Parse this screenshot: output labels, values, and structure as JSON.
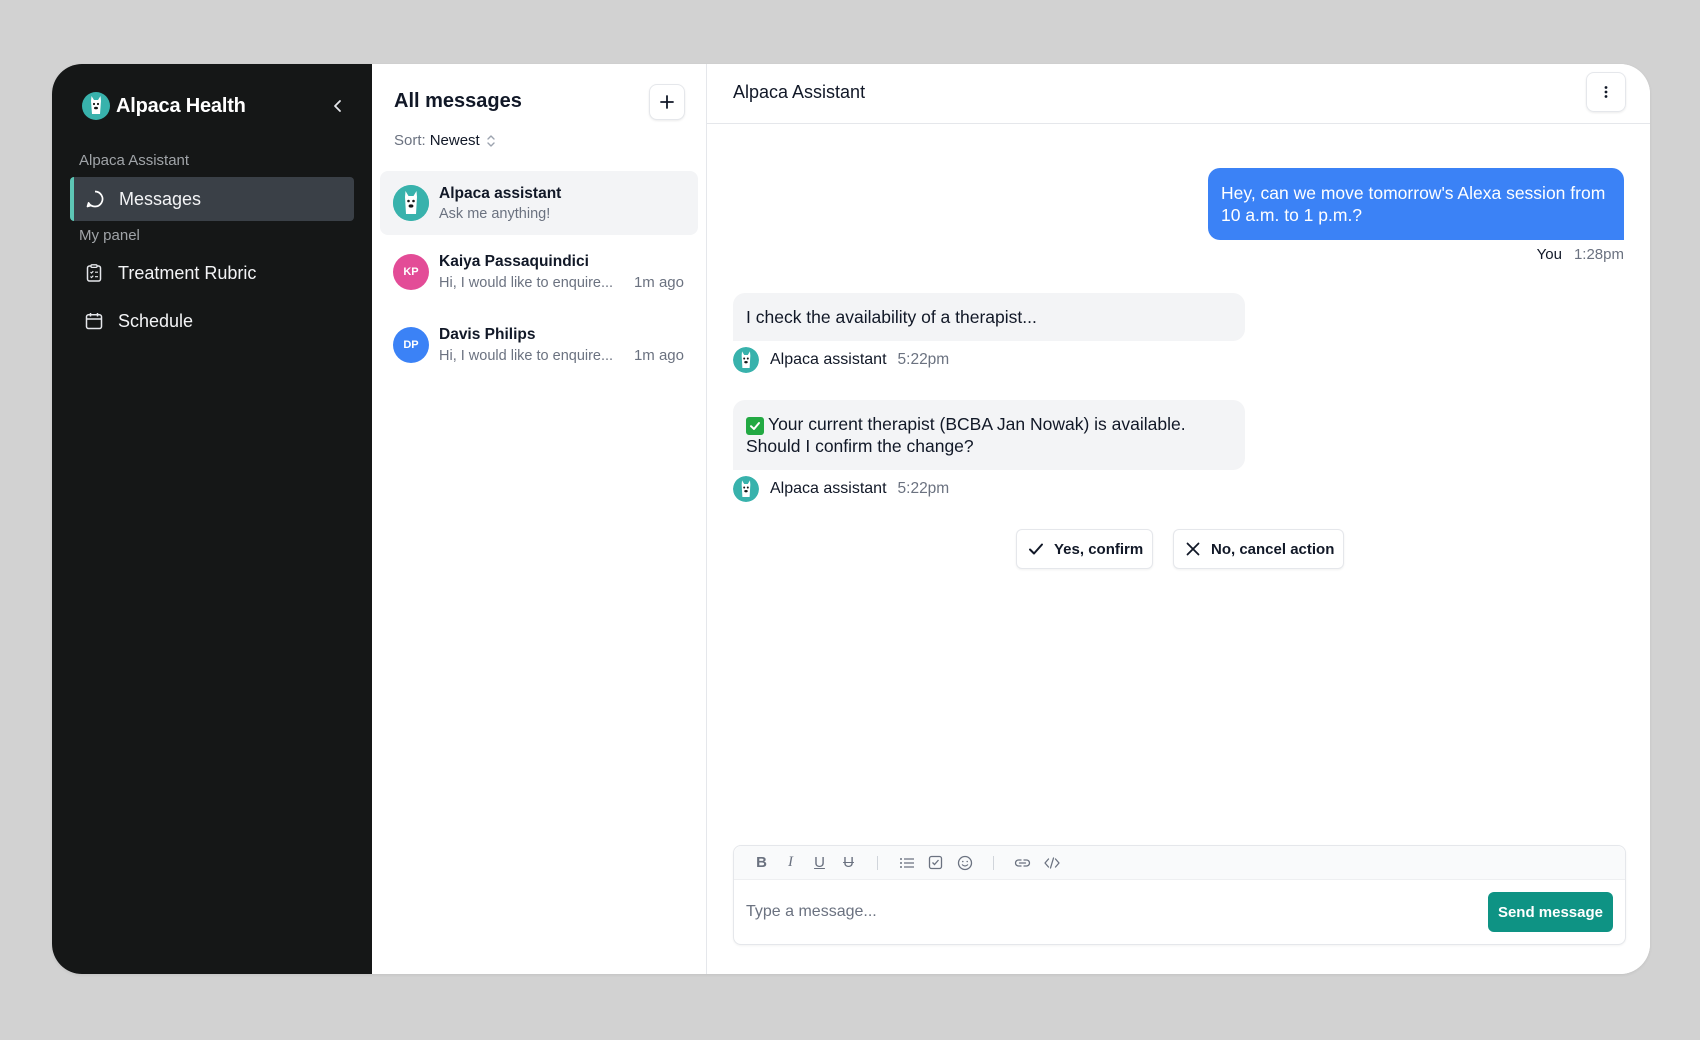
{
  "brand": {
    "name": "Alpaca Health"
  },
  "sidebar": {
    "sections": [
      {
        "label": "Alpaca Assistant"
      },
      {
        "label": "My panel"
      }
    ],
    "items": [
      {
        "label": "Messages",
        "icon": "chat-bubble-icon",
        "active": true
      },
      {
        "label": "Treatment Rubric",
        "icon": "clipboard-icon"
      },
      {
        "label": "Schedule",
        "icon": "calendar-icon"
      }
    ]
  },
  "list": {
    "title": "All messages",
    "sort_label": "Sort:",
    "sort_value": "Newest",
    "conversations": [
      {
        "name": "Alpaca assistant",
        "preview": "Ask me anything!",
        "time": "",
        "initials": "",
        "color": "#38b2ac"
      },
      {
        "name": "Kaiya Passaquindici",
        "preview": "Hi, I would like to enquire...",
        "time": "1m ago",
        "initials": "KP",
        "color": "#e34c97"
      },
      {
        "name": "Davis Philips",
        "preview": "Hi, I would like to enquire...",
        "time": "1m ago",
        "initials": "DP",
        "color": "#3b82f6"
      }
    ]
  },
  "chat": {
    "title": "Alpaca Assistant",
    "messages": [
      {
        "from": "You",
        "text": "Hey, can we move tomorrow's Alexa session from 10 a.m. to 1 p.m.?",
        "time": "1:28pm"
      },
      {
        "from": "Alpaca assistant",
        "text": "I check the availability of a therapist...",
        "time": "5:22pm"
      },
      {
        "from": "Alpaca assistant",
        "text": "Your current therapist (BCBA Jan Nowak) is available. Should I confirm the change?",
        "time": "5:22pm"
      }
    ],
    "actions": {
      "confirm": "Yes, confirm",
      "cancel": "No, cancel action"
    }
  },
  "composer": {
    "placeholder": "Type a message...",
    "send_label": "Send message",
    "tools": [
      "bold-icon",
      "italic-icon",
      "underline-icon",
      "strikethrough-icon",
      "bullet-list-icon",
      "checklist-icon",
      "emoji-icon",
      "link-icon",
      "code-icon"
    ]
  },
  "colors": {
    "sidebar_bg": "#151717",
    "accent_teal": "#0e9384",
    "bubble_blue": "#3b82f6",
    "active_indicator": "#5dc6b5"
  }
}
